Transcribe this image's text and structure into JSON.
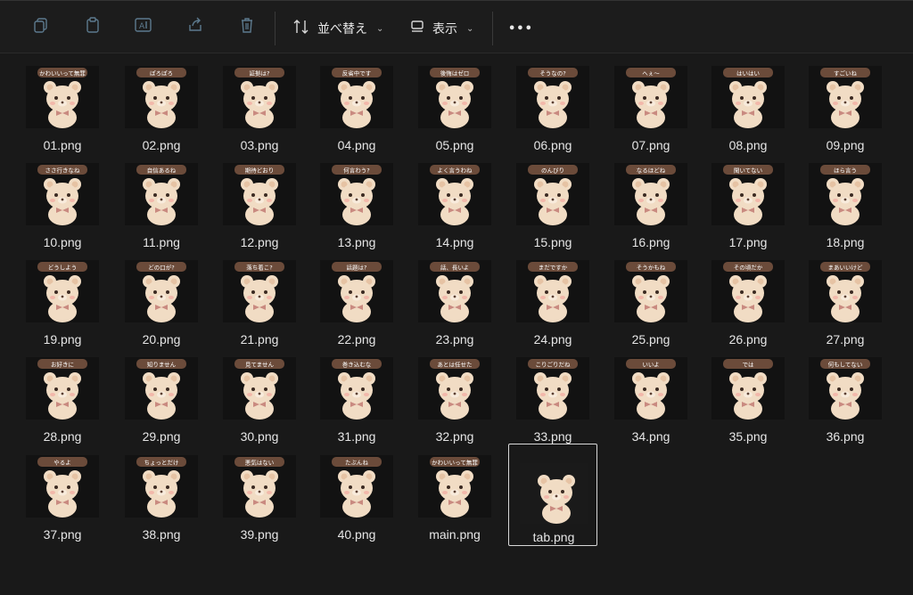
{
  "toolbar": {
    "icons": [
      "copy-icon",
      "paste-icon",
      "rename-icon",
      "share-icon",
      "delete-icon"
    ],
    "sort_label": "並べ替え",
    "view_label": "表示",
    "more_label": "•••"
  },
  "files": [
    {
      "name": "01.png",
      "caption": "かわいいって無罪"
    },
    {
      "name": "02.png",
      "caption": "ぽろぽろ"
    },
    {
      "name": "03.png",
      "caption": "証拠は?"
    },
    {
      "name": "04.png",
      "caption": "反省中です"
    },
    {
      "name": "05.png",
      "caption": "後悔はゼロ"
    },
    {
      "name": "06.png",
      "caption": "そうなの?"
    },
    {
      "name": "07.png",
      "caption": "へぇ〜"
    },
    {
      "name": "08.png",
      "caption": "はいはい"
    },
    {
      "name": "09.png",
      "caption": "すごいね"
    },
    {
      "name": "10.png",
      "caption": "ささ行きなね"
    },
    {
      "name": "11.png",
      "caption": "自信あるね"
    },
    {
      "name": "12.png",
      "caption": "期待どおり"
    },
    {
      "name": "13.png",
      "caption": "何言わう?"
    },
    {
      "name": "14.png",
      "caption": "よく言うわね"
    },
    {
      "name": "15.png",
      "caption": "のんびり"
    },
    {
      "name": "16.png",
      "caption": "なるほどね"
    },
    {
      "name": "17.png",
      "caption": "聞いてない"
    },
    {
      "name": "18.png",
      "caption": "ほら言う"
    },
    {
      "name": "19.png",
      "caption": "どうしよう"
    },
    {
      "name": "20.png",
      "caption": "どの口が?"
    },
    {
      "name": "21.png",
      "caption": "落ち着こ?"
    },
    {
      "name": "22.png",
      "caption": "話題は?"
    },
    {
      "name": "23.png",
      "caption": "話、長いよ"
    },
    {
      "name": "24.png",
      "caption": "まだですか"
    },
    {
      "name": "25.png",
      "caption": "そうかもね"
    },
    {
      "name": "26.png",
      "caption": "その頃だか"
    },
    {
      "name": "27.png",
      "caption": "まあいいけど"
    },
    {
      "name": "28.png",
      "caption": "お好きに"
    },
    {
      "name": "29.png",
      "caption": "知りません"
    },
    {
      "name": "30.png",
      "caption": "見てません"
    },
    {
      "name": "31.png",
      "caption": "巻き込むな"
    },
    {
      "name": "32.png",
      "caption": "あとは任せた"
    },
    {
      "name": "33.png",
      "caption": "こりごりだね"
    },
    {
      "name": "34.png",
      "caption": "いいよ"
    },
    {
      "name": "35.png",
      "caption": "では"
    },
    {
      "name": "36.png",
      "caption": "何もしてない"
    },
    {
      "name": "37.png",
      "caption": "やるよ"
    },
    {
      "name": "38.png",
      "caption": "ちょっとだけ"
    },
    {
      "name": "39.png",
      "caption": "悪気はない"
    },
    {
      "name": "40.png",
      "caption": "たぶんね"
    },
    {
      "name": "main.png",
      "caption": "かわいいって無罪"
    },
    {
      "name": "tab.png",
      "caption": ""
    }
  ],
  "selected_file": "tab.png",
  "colors": {
    "bear_fur": "#f1dcc4",
    "bear_ear": "#e6c3a4",
    "bow": "#c98a80",
    "caption_bg": "#6b4b3a",
    "caption_text": "#ffffff"
  }
}
